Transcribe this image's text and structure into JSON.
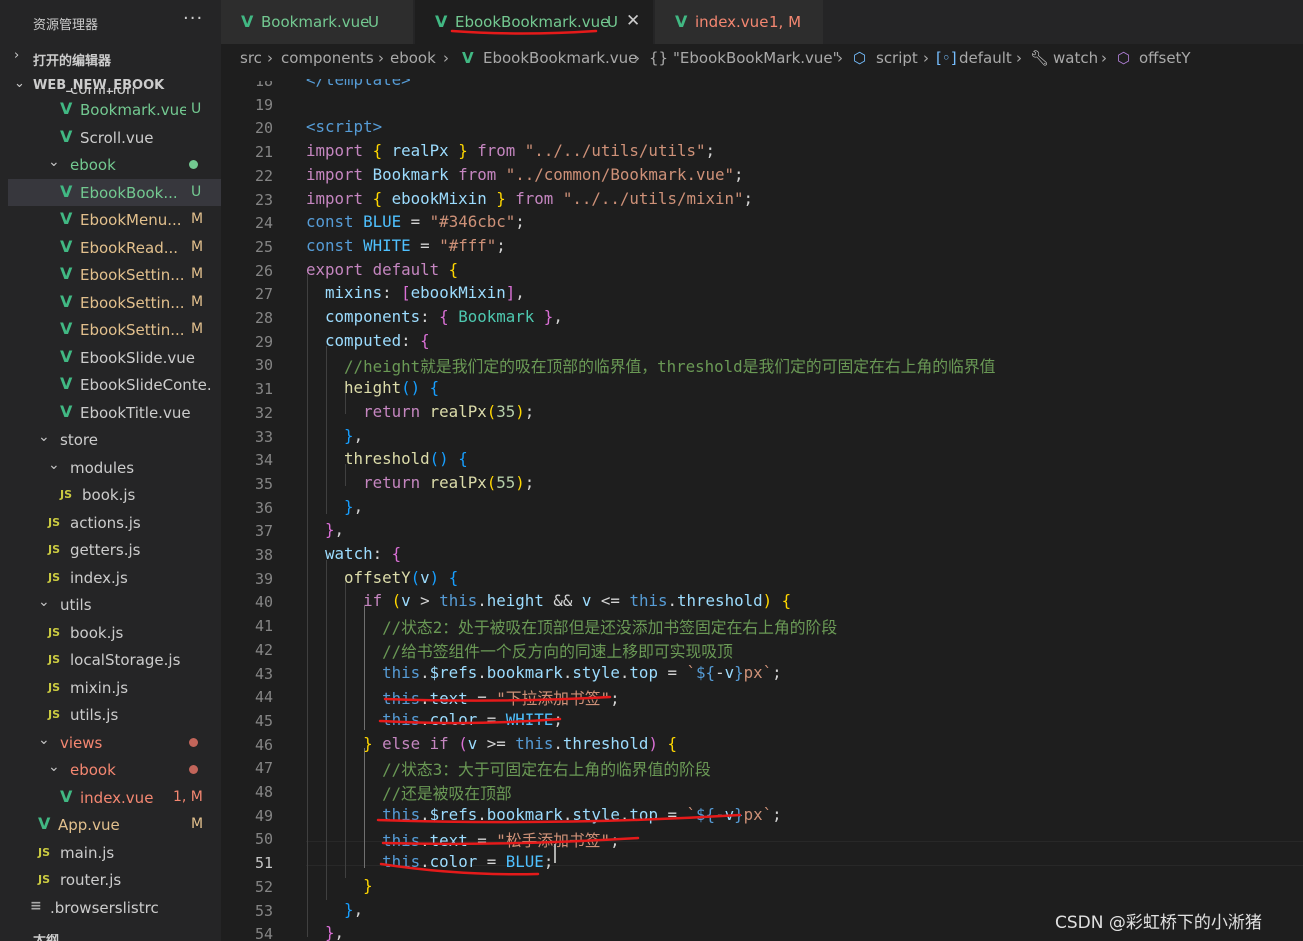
{
  "sidebar": {
    "title": "资源管理器",
    "more": "···",
    "open_editors": "打开的编辑器",
    "project": "WEB_NEW_EBOOK",
    "partial_top": "common",
    "items": [
      {
        "name": "Bookmark.vue",
        "type": "vue",
        "badge": "U",
        "color": "green"
      },
      {
        "name": "Scroll.vue",
        "type": "vue",
        "badge": "",
        "color": "white"
      },
      {
        "name": "ebook",
        "type": "folder",
        "badge": "dot",
        "color": "green"
      },
      {
        "name": "EbookBook...",
        "type": "vue",
        "badge": "U",
        "color": "green"
      },
      {
        "name": "EbookMenu...",
        "type": "vue",
        "badge": "M",
        "color": "tan"
      },
      {
        "name": "EbookRead...",
        "type": "vue",
        "badge": "M",
        "color": "tan"
      },
      {
        "name": "EbookSettin...",
        "type": "vue",
        "badge": "M",
        "color": "tan"
      },
      {
        "name": "EbookSettin...",
        "type": "vue",
        "badge": "M",
        "color": "tan"
      },
      {
        "name": "EbookSettin...",
        "type": "vue",
        "badge": "M",
        "color": "tan"
      },
      {
        "name": "EbookSlide.vue",
        "type": "vue",
        "badge": "",
        "color": "white"
      },
      {
        "name": "EbookSlideConte...",
        "type": "vue",
        "badge": "",
        "color": "white"
      },
      {
        "name": "EbookTitle.vue",
        "type": "vue",
        "badge": "",
        "color": "white"
      },
      {
        "name": "store",
        "type": "folder",
        "badge": "",
        "color": "white"
      },
      {
        "name": "modules",
        "type": "folder",
        "badge": "",
        "color": "white"
      },
      {
        "name": "book.js",
        "type": "js",
        "badge": "",
        "color": "white"
      },
      {
        "name": "actions.js",
        "type": "js",
        "badge": "",
        "color": "white"
      },
      {
        "name": "getters.js",
        "type": "js",
        "badge": "",
        "color": "white"
      },
      {
        "name": "index.js",
        "type": "js",
        "badge": "",
        "color": "white"
      },
      {
        "name": "utils",
        "type": "folder",
        "badge": "",
        "color": "white"
      },
      {
        "name": "book.js",
        "type": "js",
        "badge": "",
        "color": "white"
      },
      {
        "name": "localStorage.js",
        "type": "js",
        "badge": "",
        "color": "white"
      },
      {
        "name": "mixin.js",
        "type": "js",
        "badge": "",
        "color": "white"
      },
      {
        "name": "utils.js",
        "type": "js",
        "badge": "",
        "color": "white"
      },
      {
        "name": "views",
        "type": "folder",
        "badge": "dot",
        "color": "red"
      },
      {
        "name": "ebook",
        "type": "folder",
        "badge": "dot",
        "color": "red"
      },
      {
        "name": "index.vue",
        "type": "vue",
        "badge": "1, M",
        "color": "red"
      },
      {
        "name": "App.vue",
        "type": "vue",
        "badge": "M",
        "color": "tan"
      },
      {
        "name": "main.js",
        "type": "js",
        "badge": "",
        "color": "white"
      },
      {
        "name": "router.js",
        "type": "js",
        "badge": "",
        "color": "white"
      },
      {
        "name": ".browserslistrc",
        "type": "file",
        "badge": "",
        "color": "white"
      }
    ],
    "partial_bottom": "大纲"
  },
  "tabs": [
    {
      "label": "Bookmark.vue",
      "badge": "U"
    },
    {
      "label": "EbookBookmark.vue",
      "badge": "U",
      "close": "✕"
    },
    {
      "label": "index.vue",
      "badge": "1, M"
    }
  ],
  "breadcrumb": [
    "src",
    "components",
    "ebook",
    "EbookBookmark.vue",
    "\"EbookBookMark.vue\"",
    "script",
    "default",
    "watch",
    "offsetY"
  ],
  "editor": {
    "current_line": 51,
    "lines": [
      {
        "n": 18,
        "segs": [
          [
            "tag",
            "</template>"
          ]
        ]
      },
      {
        "n": 19,
        "segs": []
      },
      {
        "n": 20,
        "segs": [
          [
            "tag",
            "<script>"
          ]
        ]
      },
      {
        "n": 21,
        "segs": [
          [
            "kw",
            "import "
          ],
          [
            "br1",
            "{ "
          ],
          [
            "var",
            "realPx"
          ],
          [
            "br1",
            " }"
          ],
          [
            "kw",
            " from "
          ],
          [
            "str",
            "\"../../utils/utils\""
          ],
          [
            "pl",
            ";"
          ]
        ]
      },
      {
        "n": 22,
        "segs": [
          [
            "kw",
            "import "
          ],
          [
            "var",
            "Bookmark"
          ],
          [
            "kw",
            " from "
          ],
          [
            "str",
            "\"../common/Bookmark.vue\""
          ],
          [
            "pl",
            ";"
          ]
        ]
      },
      {
        "n": 23,
        "segs": [
          [
            "kw",
            "import "
          ],
          [
            "br1",
            "{ "
          ],
          [
            "var",
            "ebookMixin"
          ],
          [
            "br1",
            " }"
          ],
          [
            "kw",
            " from "
          ],
          [
            "str",
            "\"../../utils/mixin\""
          ],
          [
            "pl",
            ";"
          ]
        ]
      },
      {
        "n": 24,
        "segs": [
          [
            "st",
            "const "
          ],
          [
            "cst",
            "BLUE"
          ],
          [
            "pl",
            " = "
          ],
          [
            "str",
            "\"#346cbc\""
          ],
          [
            "pl",
            ";"
          ]
        ]
      },
      {
        "n": 25,
        "segs": [
          [
            "st",
            "const "
          ],
          [
            "cst",
            "WHITE"
          ],
          [
            "pl",
            " = "
          ],
          [
            "str",
            "\"#fff\""
          ],
          [
            "pl",
            ";"
          ]
        ]
      },
      {
        "n": 26,
        "segs": [
          [
            "kw",
            "export default "
          ],
          [
            "br1",
            "{"
          ]
        ]
      },
      {
        "n": 27,
        "segs": [
          [
            "pl",
            "  "
          ],
          [
            "var",
            "mixins"
          ],
          [
            "pl",
            ": "
          ],
          [
            "br2",
            "["
          ],
          [
            "var",
            "ebookMixin"
          ],
          [
            "br2",
            "]"
          ],
          [
            "pl",
            ","
          ]
        ]
      },
      {
        "n": 28,
        "segs": [
          [
            "pl",
            "  "
          ],
          [
            "var",
            "components"
          ],
          [
            "pl",
            ": "
          ],
          [
            "br2",
            "{ "
          ],
          [
            "cls",
            "Bookmark"
          ],
          [
            "br2",
            " }"
          ],
          [
            "pl",
            ","
          ]
        ]
      },
      {
        "n": 29,
        "segs": [
          [
            "pl",
            "  "
          ],
          [
            "var",
            "computed"
          ],
          [
            "pl",
            ": "
          ],
          [
            "br2",
            "{"
          ]
        ]
      },
      {
        "n": 30,
        "segs": [
          [
            "pl",
            "    "
          ],
          [
            "cmt",
            "//height就是我们定的吸在顶部的临界值，threshold是我们定的可固定在右上角的临界值"
          ]
        ]
      },
      {
        "n": 31,
        "segs": [
          [
            "pl",
            "    "
          ],
          [
            "fn",
            "height"
          ],
          [
            "br3",
            "()"
          ],
          [
            "pl",
            " "
          ],
          [
            "br3",
            "{"
          ]
        ]
      },
      {
        "n": 32,
        "segs": [
          [
            "pl",
            "      "
          ],
          [
            "kw",
            "return "
          ],
          [
            "fn",
            "realPx"
          ],
          [
            "br1",
            "("
          ],
          [
            "num",
            "35"
          ],
          [
            "br1",
            ")"
          ],
          [
            "pl",
            ";"
          ]
        ]
      },
      {
        "n": 33,
        "segs": [
          [
            "pl",
            "    "
          ],
          [
            "br3",
            "}"
          ],
          [
            "pl",
            ","
          ]
        ]
      },
      {
        "n": 34,
        "segs": [
          [
            "pl",
            "    "
          ],
          [
            "fn",
            "threshold"
          ],
          [
            "br3",
            "()"
          ],
          [
            "pl",
            " "
          ],
          [
            "br3",
            "{"
          ]
        ]
      },
      {
        "n": 35,
        "segs": [
          [
            "pl",
            "      "
          ],
          [
            "kw",
            "return "
          ],
          [
            "fn",
            "realPx"
          ],
          [
            "br1",
            "("
          ],
          [
            "num",
            "55"
          ],
          [
            "br1",
            ")"
          ],
          [
            "pl",
            ";"
          ]
        ]
      },
      {
        "n": 36,
        "segs": [
          [
            "pl",
            "    "
          ],
          [
            "br3",
            "}"
          ],
          [
            "pl",
            ","
          ]
        ]
      },
      {
        "n": 37,
        "segs": [
          [
            "pl",
            "  "
          ],
          [
            "br2",
            "}"
          ],
          [
            "pl",
            ","
          ]
        ]
      },
      {
        "n": 38,
        "segs": [
          [
            "pl",
            "  "
          ],
          [
            "var",
            "watch"
          ],
          [
            "pl",
            ": "
          ],
          [
            "br2",
            "{"
          ]
        ]
      },
      {
        "n": 39,
        "segs": [
          [
            "pl",
            "    "
          ],
          [
            "fn",
            "offsetY"
          ],
          [
            "br3",
            "("
          ],
          [
            "var",
            "v"
          ],
          [
            "br3",
            ")"
          ],
          [
            "pl",
            " "
          ],
          [
            "br3",
            "{"
          ]
        ]
      },
      {
        "n": 40,
        "segs": [
          [
            "pl",
            "      "
          ],
          [
            "kw",
            "if "
          ],
          [
            "br1",
            "("
          ],
          [
            "var",
            "v"
          ],
          [
            "pl",
            " > "
          ],
          [
            "st",
            "this"
          ],
          [
            "pl",
            "."
          ],
          [
            "var",
            "height"
          ],
          [
            "pl",
            " && "
          ],
          [
            "var",
            "v"
          ],
          [
            "pl",
            " <= "
          ],
          [
            "st",
            "this"
          ],
          [
            "pl",
            "."
          ],
          [
            "var",
            "threshold"
          ],
          [
            "br1",
            ")"
          ],
          [
            "pl",
            " "
          ],
          [
            "br1",
            "{"
          ]
        ]
      },
      {
        "n": 41,
        "segs": [
          [
            "pl",
            "        "
          ],
          [
            "cmt",
            "//状态2：处于被吸在顶部但是还没添加书签固定在右上角的阶段"
          ]
        ]
      },
      {
        "n": 42,
        "segs": [
          [
            "pl",
            "        "
          ],
          [
            "cmt",
            "//给书签组件一个反方向的同速上移即可实现吸顶"
          ]
        ]
      },
      {
        "n": 43,
        "segs": [
          [
            "pl",
            "        "
          ],
          [
            "st",
            "this"
          ],
          [
            "pl",
            "."
          ],
          [
            "var",
            "$refs"
          ],
          [
            "pl",
            "."
          ],
          [
            "var",
            "bookmark"
          ],
          [
            "pl",
            "."
          ],
          [
            "var",
            "style"
          ],
          [
            "pl",
            "."
          ],
          [
            "var",
            "top"
          ],
          [
            "pl",
            " = "
          ],
          [
            "str",
            "`"
          ],
          [
            "st",
            "${"
          ],
          [
            "pl",
            "-"
          ],
          [
            "var",
            "v"
          ],
          [
            "st",
            "}"
          ],
          [
            "str",
            "px`"
          ],
          [
            "pl",
            ";"
          ]
        ]
      },
      {
        "n": 44,
        "segs": [
          [
            "pl",
            "        "
          ],
          [
            "st",
            "this"
          ],
          [
            "pl",
            "."
          ],
          [
            "var",
            "text"
          ],
          [
            "pl",
            " = "
          ],
          [
            "str",
            "\"下拉添加书签\""
          ],
          [
            "pl",
            ";"
          ]
        ]
      },
      {
        "n": 45,
        "segs": [
          [
            "pl",
            "        "
          ],
          [
            "st",
            "this"
          ],
          [
            "pl",
            "."
          ],
          [
            "var",
            "color"
          ],
          [
            "pl",
            " = "
          ],
          [
            "cst",
            "WHITE"
          ],
          [
            "pl",
            ";"
          ]
        ]
      },
      {
        "n": 46,
        "segs": [
          [
            "pl",
            "      "
          ],
          [
            "br1",
            "}"
          ],
          [
            "kw",
            " else if "
          ],
          [
            "br2",
            "("
          ],
          [
            "var",
            "v"
          ],
          [
            "pl",
            " >= "
          ],
          [
            "st",
            "this"
          ],
          [
            "pl",
            "."
          ],
          [
            "var",
            "threshold"
          ],
          [
            "br2",
            ")"
          ],
          [
            "pl",
            " "
          ],
          [
            "br1",
            "{"
          ]
        ]
      },
      {
        "n": 47,
        "segs": [
          [
            "pl",
            "        "
          ],
          [
            "cmt",
            "//状态3：大于可固定在右上角的临界值的阶段"
          ]
        ]
      },
      {
        "n": 48,
        "segs": [
          [
            "pl",
            "        "
          ],
          [
            "cmt",
            "//还是被吸在顶部"
          ]
        ]
      },
      {
        "n": 49,
        "segs": [
          [
            "pl",
            "        "
          ],
          [
            "st",
            "this"
          ],
          [
            "pl",
            "."
          ],
          [
            "var",
            "$refs"
          ],
          [
            "pl",
            "."
          ],
          [
            "var",
            "bookmark"
          ],
          [
            "pl",
            "."
          ],
          [
            "var",
            "style"
          ],
          [
            "pl",
            "."
          ],
          [
            "var",
            "top"
          ],
          [
            "pl",
            " = "
          ],
          [
            "str",
            "`"
          ],
          [
            "st",
            "${"
          ],
          [
            "pl",
            "-"
          ],
          [
            "var",
            "v"
          ],
          [
            "st",
            "}"
          ],
          [
            "str",
            "px`"
          ],
          [
            "pl",
            ";"
          ]
        ]
      },
      {
        "n": 50,
        "segs": [
          [
            "pl",
            "        "
          ],
          [
            "st",
            "this"
          ],
          [
            "pl",
            "."
          ],
          [
            "var",
            "text"
          ],
          [
            "pl",
            " = "
          ],
          [
            "str",
            "\"松手添加书签\""
          ],
          [
            "pl",
            ";"
          ]
        ]
      },
      {
        "n": 51,
        "segs": [
          [
            "pl",
            "        "
          ],
          [
            "st",
            "this"
          ],
          [
            "pl",
            "."
          ],
          [
            "var",
            "color"
          ],
          [
            "pl",
            " = "
          ],
          [
            "cst",
            "BLUE"
          ],
          [
            "pl",
            ";"
          ]
        ]
      },
      {
        "n": 52,
        "segs": [
          [
            "pl",
            "      "
          ],
          [
            "br1",
            "}"
          ]
        ]
      },
      {
        "n": 53,
        "segs": [
          [
            "pl",
            "    "
          ],
          [
            "br3",
            "}"
          ],
          [
            "pl",
            ","
          ]
        ]
      },
      {
        "n": 54,
        "segs": [
          [
            "pl",
            "  "
          ],
          [
            "br2",
            "}"
          ],
          [
            "pl",
            ","
          ]
        ]
      }
    ]
  },
  "watermark": "CSDN @彩虹桥下的小淅猪",
  "colors": {
    "annotation": "#e51a1a",
    "vue_icon": "#41b883",
    "untracked": "#73c991",
    "modified": "#e2c08d",
    "error": "#f48771"
  }
}
